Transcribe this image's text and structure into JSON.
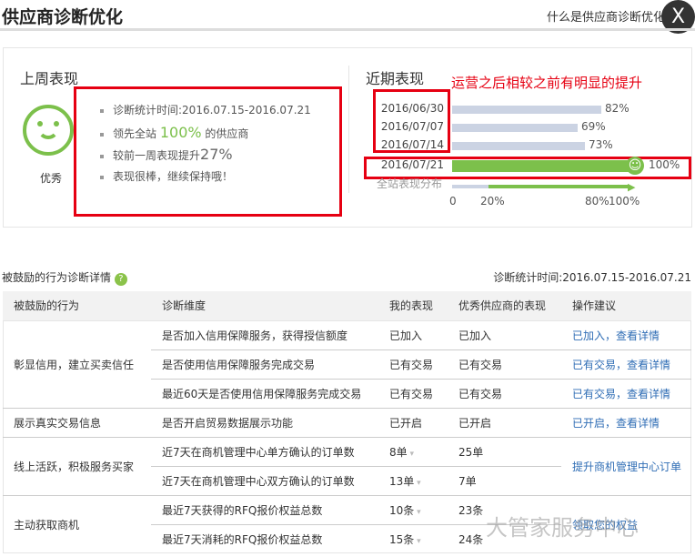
{
  "header": {
    "title": "供应商诊断优化",
    "help_link": "什么是供应商诊断优化",
    "close_label": "X"
  },
  "last_week": {
    "title": "上周表现",
    "rating": "优秀",
    "items": [
      "诊断统计时间:2016.07.15-2016.07.21"
    ],
    "lead_prefix": "领先全站",
    "lead_value": "100%",
    "lead_suffix": "的供应商",
    "improve_prefix": "较前一周表现提升",
    "improve_value": "27%",
    "comment": "表现很棒，继续保持哦！"
  },
  "recent": {
    "title": "近期表现",
    "annotation": "运营之后相较之前有明显的提升",
    "distribution_label": "全站表现分布",
    "axis_ticks": [
      "0",
      "20%",
      "80%",
      "100%"
    ]
  },
  "chart_data": {
    "type": "bar",
    "categories": [
      "2016/06/30",
      "2016/07/07",
      "2016/07/14",
      "2016/07/21"
    ],
    "values": [
      82,
      69,
      73,
      100
    ],
    "labels": [
      "82%",
      "69%",
      "73%",
      "100%"
    ],
    "xlim": [
      0,
      100
    ]
  },
  "details": {
    "title": "被鼓励的行为诊断详情",
    "help_icon": "?",
    "period": "诊断统计时间:2016.07.15-2016.07.21",
    "headers": [
      "被鼓励的行为",
      "诊断维度",
      "我的表现",
      "优秀供应商的表现",
      "操作建议"
    ],
    "groups": [
      {
        "name": "彰显信用，建立买卖信任",
        "rows": [
          [
            "是否加入信用保障服务，获得授信额度",
            "已加入",
            "已加入",
            "已加入，查看详情"
          ],
          [
            "是否使用信用保障服务完成交易",
            "已有交易",
            "已有交易",
            "已有交易，查看详情"
          ],
          [
            "最近60天是否使用信用保障服务完成交易",
            "已有交易",
            "已有交易",
            "已有交易，查看详情"
          ]
        ]
      },
      {
        "name": "展示真实交易信息",
        "rows": [
          [
            "是否开启贸易数据展示功能",
            "已开启",
            "已开启",
            "已开启，查看详情"
          ]
        ]
      },
      {
        "name": "线上活跃，积极服务买家",
        "action": "提升商机管理中心订单",
        "rows": [
          [
            "近7天在商机管理中心单方确认的订单数",
            "8单",
            "25单"
          ],
          [
            "近7天在商机管理中心双方确认的订单数",
            "13单",
            "7单"
          ]
        ]
      },
      {
        "name": "主动获取商机",
        "action": "领取您的权益",
        "rows": [
          [
            "最近7天获得的RFQ报价权益总数",
            "10条",
            "23条"
          ],
          [
            "最近7天消耗的RFQ报价权益总数",
            "15条",
            "24条"
          ]
        ]
      }
    ]
  },
  "watermark": "大管家服务中心"
}
